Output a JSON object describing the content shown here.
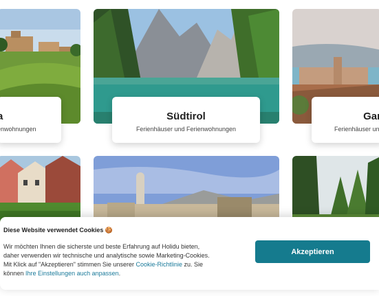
{
  "cards": [
    {
      "title": "a",
      "subtitle": "enwohnungen"
    },
    {
      "title": "Südtirol",
      "subtitle": "Ferienhäuser und Ferienwohnungen"
    },
    {
      "title": "Gar",
      "subtitle": "Ferienhäuser und"
    }
  ],
  "cookie_banner": {
    "heading": "Diese Website verwendet Cookies 🍪",
    "body_line1": "Wir möchten Ihnen die sicherste und beste Erfahrung auf Holidu bieten,",
    "body_line2": "daher verwenden wir technische und analytische sowie Marketing-Cookies.",
    "body_line3_prefix": "Mit Klick auf \"Akzeptieren\" stimmen Sie unserer ",
    "policy_link": "Cookie-Richtlinie",
    "body_line3_suffix": " zu. Sie",
    "body_line4_prefix": "können ",
    "settings_link": "Ihre Einstellungen auch anpassen",
    "body_line4_suffix": ".",
    "accept_label": "Akzeptieren"
  },
  "colors": {
    "accept_button": "#157b8e",
    "link": "#1a7a9a"
  }
}
